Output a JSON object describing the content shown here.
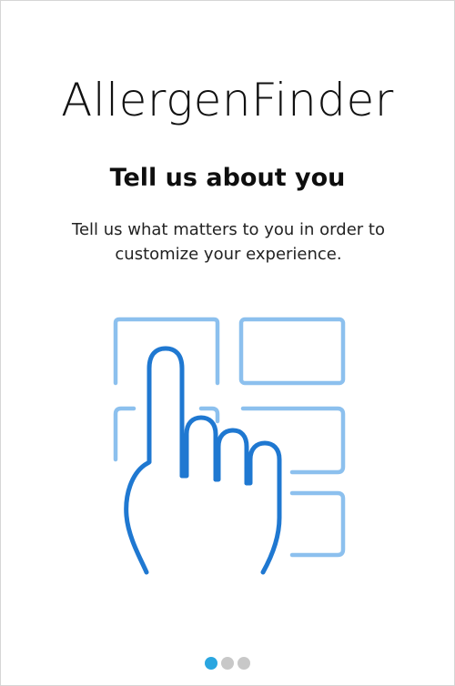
{
  "app": {
    "title": "AllergenFinder"
  },
  "onboarding": {
    "heading": "Tell us about you",
    "description": "Tell us what matters to you in order to customize your experience.",
    "illustration_icon": "hand-tapping-touchscreen-icon",
    "pager": {
      "total_pages": 3,
      "current_page": 1
    }
  },
  "colors": {
    "pager_active": "#2aa6e0",
    "pager_inactive": "#c8c8c8",
    "illustration_light": "#8cc0ee",
    "illustration_dark": "#1f78d1"
  }
}
